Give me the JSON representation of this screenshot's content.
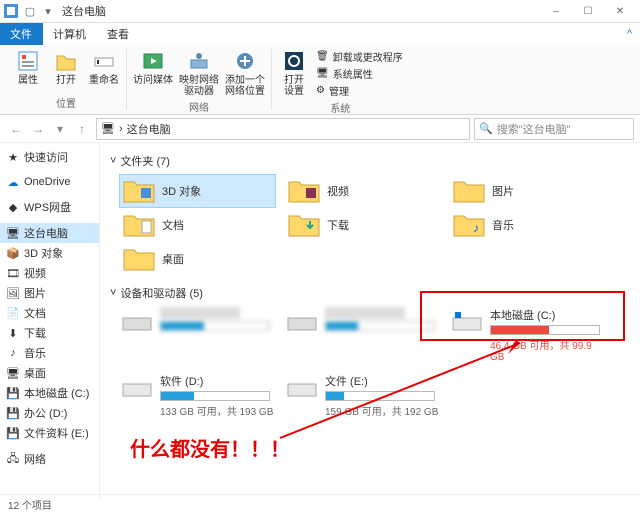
{
  "window": {
    "title": "这台电脑",
    "min": "–",
    "max": "☐",
    "close": "✕"
  },
  "tabs": {
    "file": "文件",
    "computer": "计算机",
    "view": "查看"
  },
  "ribbon": {
    "properties": "属性",
    "open": "打开",
    "rename": "重命名",
    "access_media": "访问媒体",
    "map_network": "映射网络\n驱动器",
    "add_location": "添加一个\n网络位置",
    "open_settings": "打开\n设置",
    "uninstall": "卸载或更改程序",
    "sys_properties": "系统属性",
    "manage": "管理",
    "grp_location": "位置",
    "grp_network": "网络",
    "grp_system": "系统"
  },
  "nav": {
    "back": "←",
    "fwd": "→",
    "up": "↑",
    "this_pc": "这台电脑",
    "chevron": "›"
  },
  "search": {
    "placeholder": "搜索\"这台电脑\"",
    "icon": "🔍"
  },
  "sidebar": {
    "quick": "快速访问",
    "onedrive": "OneDrive",
    "wps": "WPS网盘",
    "thispc": "这台电脑",
    "objects3d": "3D 对象",
    "videos": "视频",
    "pictures": "图片",
    "documents": "文档",
    "downloads": "下载",
    "music": "音乐",
    "desktop": "桌面",
    "localc": "本地磁盘 (C:)",
    "office": "办公 (D:)",
    "docse": "文件资料 (E:)",
    "network": "网络"
  },
  "sections": {
    "folders": "文件夹 (7)",
    "drives": "设备和驱动器 (5)"
  },
  "folders": {
    "objects3d": "3D 对象",
    "videos": "视频",
    "pictures": "图片",
    "documents": "文档",
    "downloads": "下载",
    "music": "音乐",
    "desktop": "桌面"
  },
  "drives": {
    "c": {
      "name": "本地磁盘 (C:)",
      "sub": "46.4 GB 可用，共 99.9 GB"
    },
    "d": {
      "name": "软件 (D:)",
      "sub": "133 GB 可用，共 193 GB"
    },
    "e": {
      "name": "文件 (E:)",
      "sub": "159 GB 可用，共 192 GB"
    }
  },
  "annotation": "什么都没有！！！",
  "status": "12 个项目"
}
